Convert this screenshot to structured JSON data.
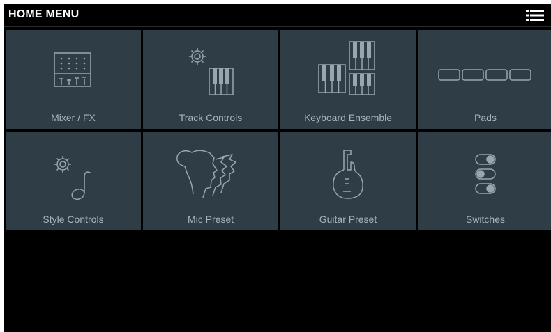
{
  "header": {
    "title": "HOME MENU",
    "menu_icon": "hamburger-list-icon"
  },
  "tiles": [
    {
      "label": "Mixer / FX",
      "icon": "mixer-icon"
    },
    {
      "label": "Track Controls",
      "icon": "gear-keyboard-icon"
    },
    {
      "label": "Keyboard Ensemble",
      "icon": "keyboards-icon"
    },
    {
      "label": "Pads",
      "icon": "pads-icon"
    },
    {
      "label": "Style Controls",
      "icon": "gear-music-note-icon"
    },
    {
      "label": "Mic Preset",
      "icon": "faces-profile-icon"
    },
    {
      "label": "Guitar Preset",
      "icon": "guitar-icon"
    },
    {
      "label": "Switches",
      "icon": "switches-icon"
    }
  ],
  "colors": {
    "tile_bg": "#2e3d46",
    "icon_stroke": "#9aa6ad",
    "label": "#a9b4ba",
    "background": "#000000"
  }
}
